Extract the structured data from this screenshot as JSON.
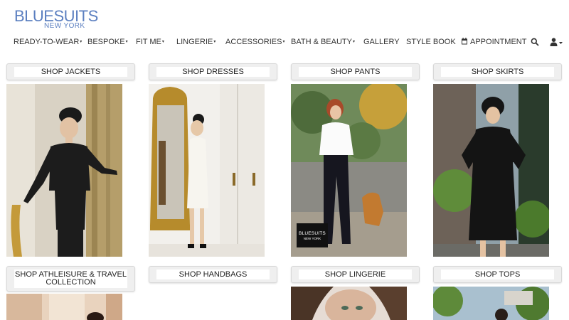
{
  "logo": {
    "brand": "BLUESUITS",
    "city": "NEW YORK"
  },
  "nav": {
    "items": [
      {
        "label": "READY-TO-WEAR",
        "dropdown": true
      },
      {
        "label": "BESPOKE",
        "dropdown": true
      },
      {
        "label": "FIT ME",
        "dropdown": true
      },
      {
        "label": "LINGERIE",
        "dropdown": true
      },
      {
        "label": "ACCESSORIES",
        "dropdown": true
      },
      {
        "label": "BATH & BEAUTY",
        "dropdown": true
      },
      {
        "label": "GALLERY",
        "dropdown": false
      },
      {
        "label": "STYLE BOOK",
        "dropdown": false
      },
      {
        "label": "APPOINTMENT",
        "dropdown": false,
        "icon": "calendar-icon"
      }
    ],
    "search_icon": "search-icon",
    "user_icon": "user-icon",
    "caret": "▾"
  },
  "categories": [
    {
      "label": "SHOP JACKETS"
    },
    {
      "label": "SHOP DRESSES"
    },
    {
      "label": "SHOP PANTS"
    },
    {
      "label": "SHOP SKIRTS"
    },
    {
      "label": "SHOP ATHLEISURE & TRAVEL COLLECTION"
    },
    {
      "label": "SHOP HANDBAGS"
    },
    {
      "label": "SHOP LINGERIE"
    },
    {
      "label": "SHOP TOPS"
    }
  ],
  "photo_badge": {
    "brand": "BLUESUITS",
    "city": "NEW YORK"
  },
  "colors": {
    "logo": "#5b7fc0",
    "header_bg": "#efefef",
    "text": "#222222"
  }
}
